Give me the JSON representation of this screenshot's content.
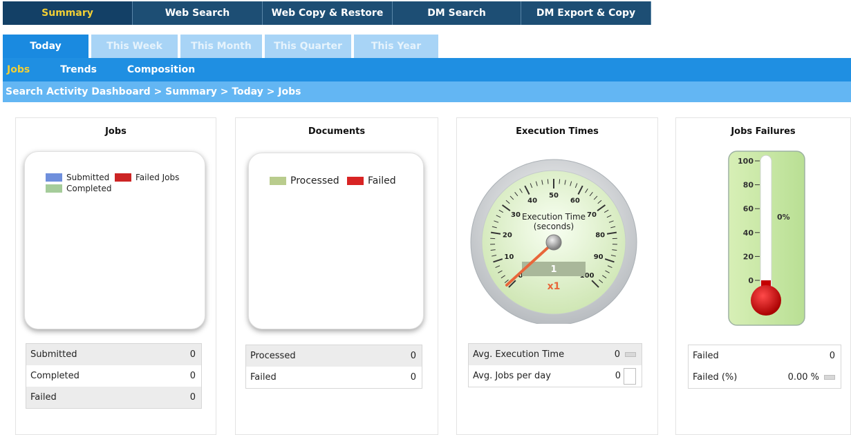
{
  "top_nav": [
    {
      "label": "Summary",
      "active": true
    },
    {
      "label": "Web Search",
      "active": false
    },
    {
      "label": "Web Copy & Restore",
      "active": false
    },
    {
      "label": "DM Search",
      "active": false
    },
    {
      "label": "DM Export & Copy",
      "active": false
    }
  ],
  "time_tabs": [
    {
      "label": "Today",
      "active": true
    },
    {
      "label": "This Week",
      "active": false
    },
    {
      "label": "This Month",
      "active": false
    },
    {
      "label": "This Quarter",
      "active": false
    },
    {
      "label": "This Year",
      "active": false
    }
  ],
  "sub_nav": [
    {
      "label": "Jobs",
      "active": true
    },
    {
      "label": "Trends",
      "active": false
    },
    {
      "label": "Composition",
      "active": false
    }
  ],
  "breadcrumb": "Search Activity Dashboard > Summary > Today > Jobs",
  "jobs": {
    "title": "Jobs",
    "legend": {
      "submitted": {
        "label": "Submitted",
        "color": "#6f8fdc"
      },
      "completed": {
        "label": "Completed",
        "color": "#a5cc9a"
      },
      "failed": {
        "label": "Failed Jobs",
        "color": "#cc2424"
      }
    },
    "stats": [
      {
        "label": "Submitted",
        "value": "0"
      },
      {
        "label": "Completed",
        "value": "0"
      },
      {
        "label": "Failed",
        "value": "0"
      }
    ]
  },
  "documents": {
    "title": "Documents",
    "legend": {
      "processed": {
        "label": "Processed",
        "color": "#b9cc8d"
      },
      "failed": {
        "label": "Failed",
        "color": "#d82424"
      }
    },
    "stats": [
      {
        "label": "Processed",
        "value": "0"
      },
      {
        "label": "Failed",
        "value": "0"
      }
    ]
  },
  "execution": {
    "title": "Execution Times",
    "gauge_label_line1": "Execution Time",
    "gauge_label_line2": "(seconds)",
    "gauge_ticks": [
      "0",
      "10",
      "20",
      "30",
      "40",
      "50",
      "60",
      "70",
      "80",
      "90",
      "100"
    ],
    "gauge_value": 1,
    "gauge_multiplier": "x1",
    "stats": [
      {
        "label": "Avg. Execution Time",
        "value": "0"
      },
      {
        "label": "Avg. Jobs per day",
        "value": "0"
      }
    ]
  },
  "failures": {
    "title": "Jobs Failures",
    "thermo_ticks": [
      "100",
      "80",
      "60",
      "40",
      "20",
      "0"
    ],
    "thermo_value": 0,
    "thermo_label": "0%",
    "stats": [
      {
        "label": "Failed",
        "value": "0"
      },
      {
        "label": "Failed (%)",
        "value": "0.00 %"
      }
    ]
  }
}
